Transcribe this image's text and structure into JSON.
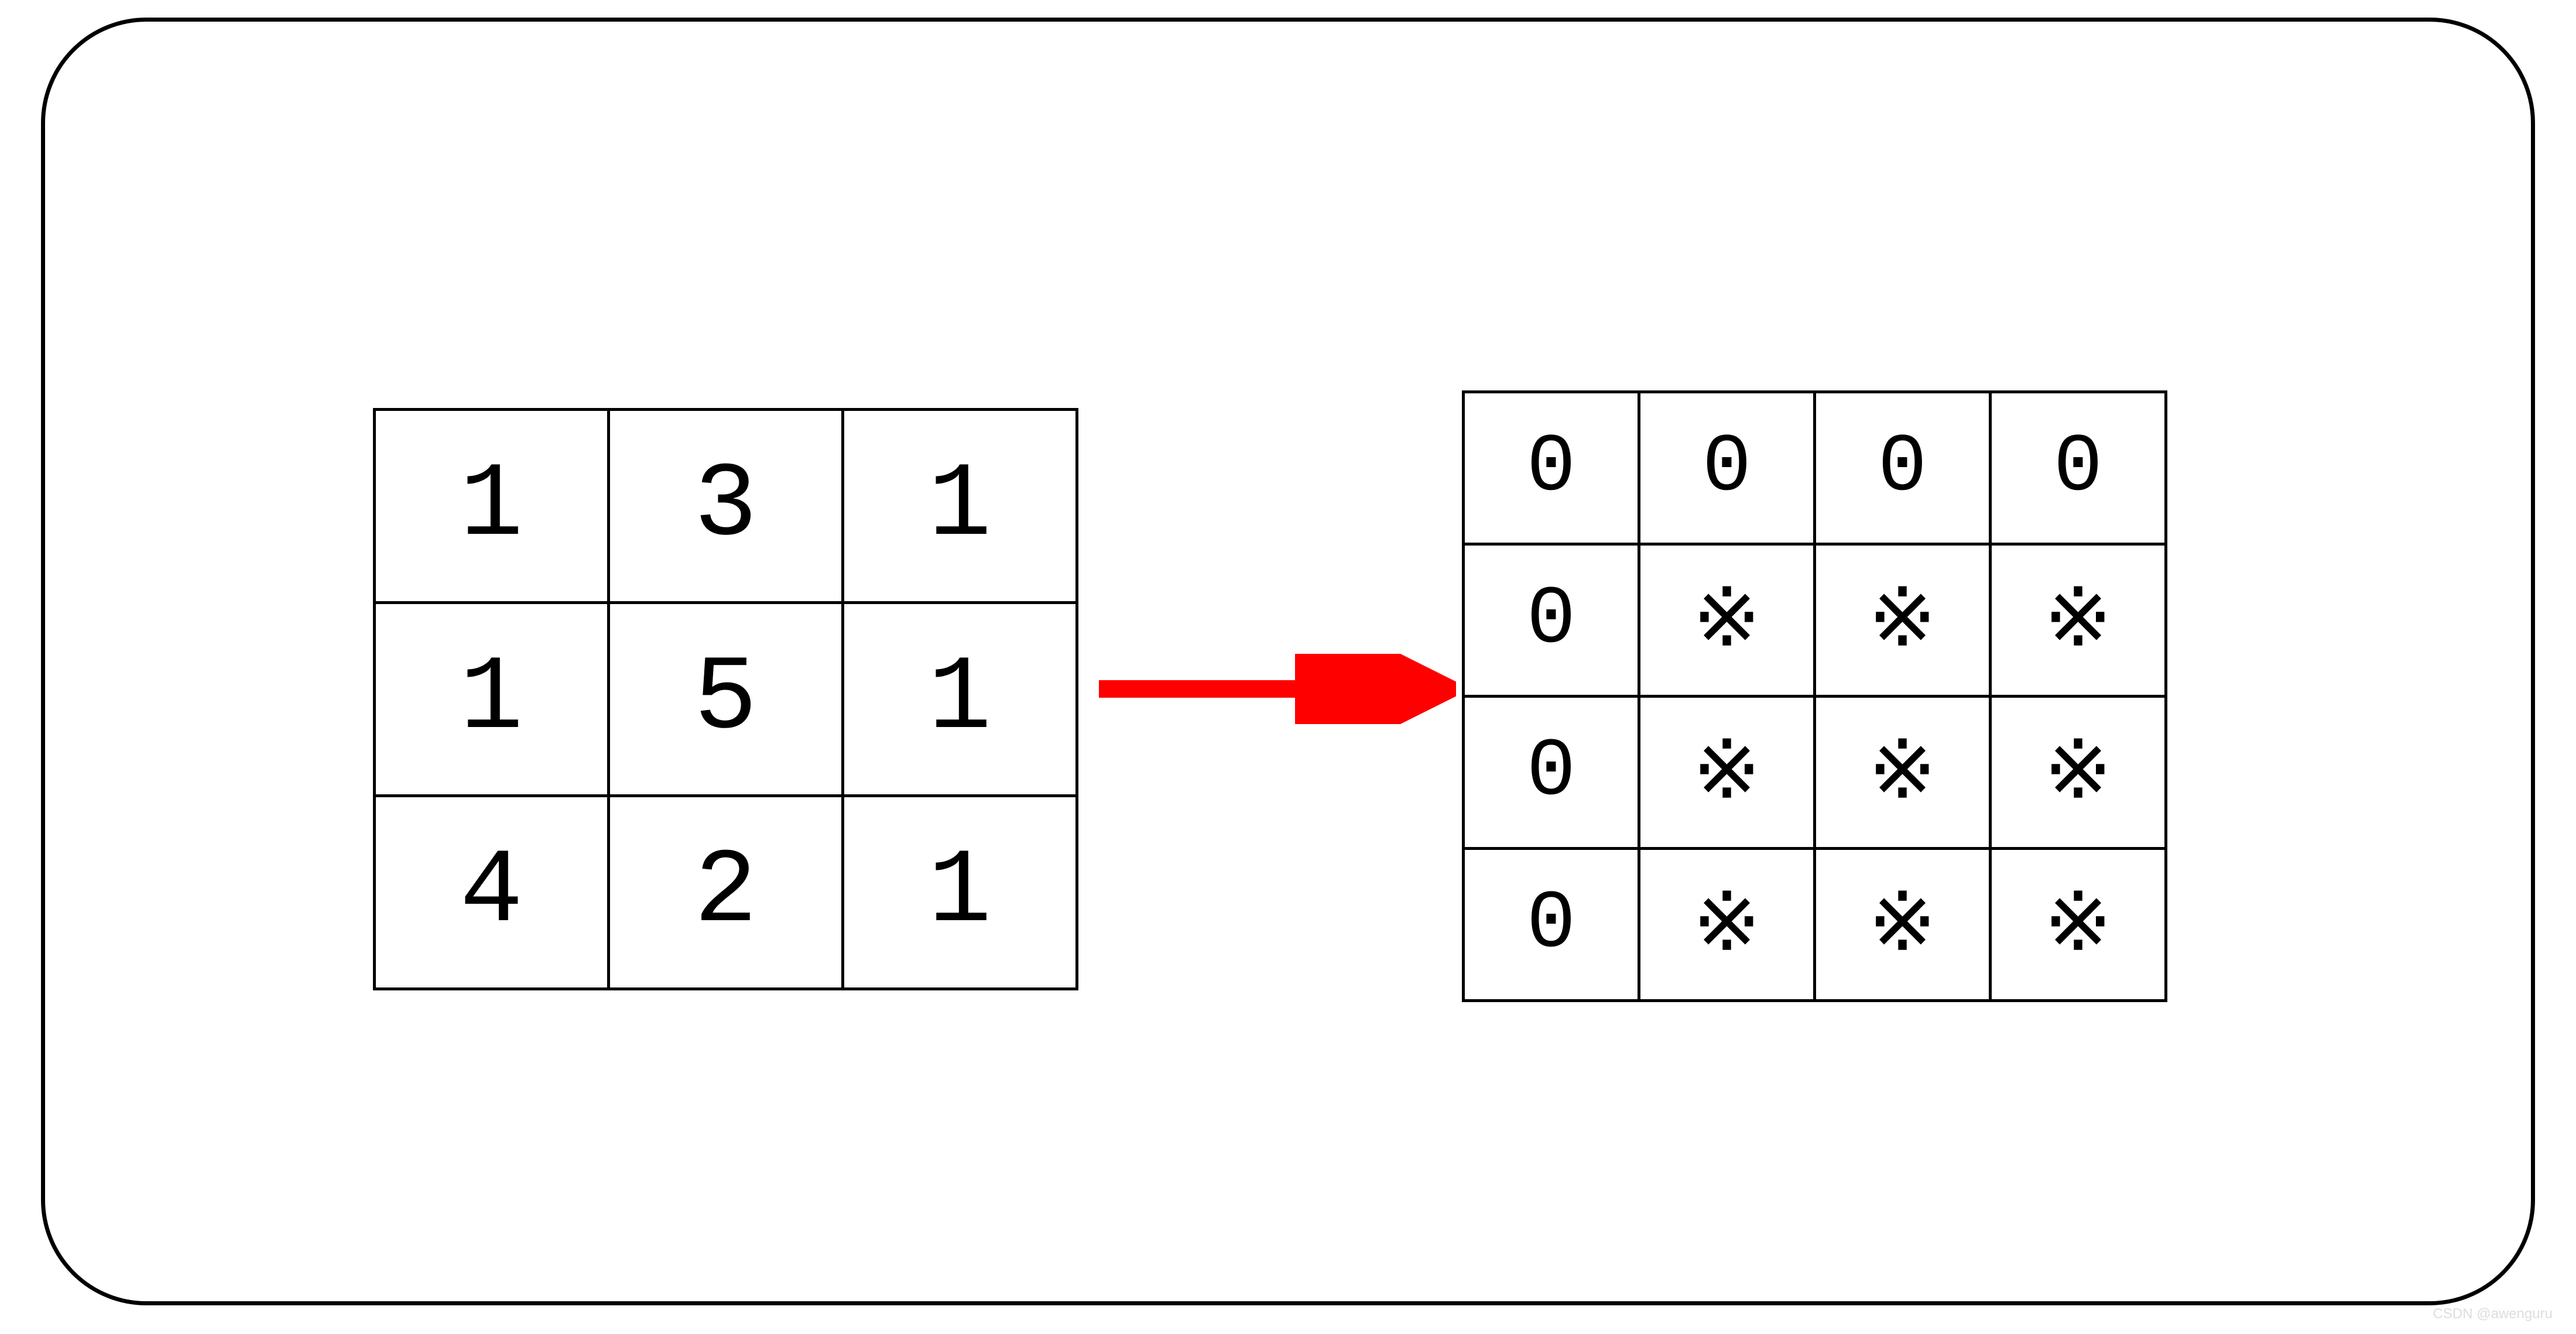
{
  "left_grid": {
    "rows": [
      [
        "1",
        "3",
        "1"
      ],
      [
        "1",
        "5",
        "1"
      ],
      [
        "4",
        "2",
        "1"
      ]
    ]
  },
  "right_grid": {
    "rows": [
      [
        "0",
        "0",
        "0",
        "0"
      ],
      [
        "0",
        "※",
        "※",
        "※"
      ],
      [
        "0",
        "※",
        "※",
        "※"
      ],
      [
        "0",
        "※",
        "※",
        "※"
      ]
    ]
  },
  "arrow": {
    "color": "#FF0000"
  },
  "watermark": "CSDN @awenguru"
}
